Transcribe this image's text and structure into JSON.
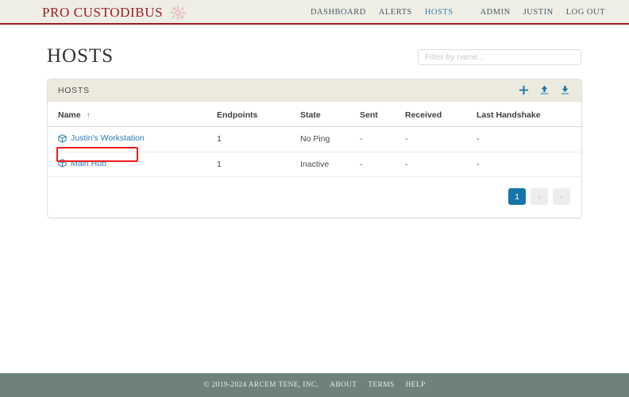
{
  "colors": {
    "brand_red": "#9b1b28",
    "header_bg": "#eeeee4",
    "link_blue": "#2a7ab0",
    "accent_blue": "#1675a8",
    "danger_red": "#f0554c",
    "footer_bg": "#6e8279",
    "annotation_red": "#ee1b1b"
  },
  "header": {
    "brand_name": "PRO CUSTODIBUS",
    "logo_icon": "sunburst-emblem-icon",
    "nav_primary": [
      {
        "label": "DASHBOARD",
        "active": false
      },
      {
        "label": "ALERTS",
        "active": false
      },
      {
        "label": "HOSTS",
        "active": true
      }
    ],
    "nav_secondary": [
      {
        "label": "ADMIN"
      },
      {
        "label": "JUSTIN"
      },
      {
        "label": "LOG OUT"
      }
    ]
  },
  "page": {
    "title": "HOSTS"
  },
  "search": {
    "placeholder": "Filter by name...",
    "value": ""
  },
  "card": {
    "title": "HOSTS",
    "actions": [
      {
        "name": "add-host-button",
        "icon": "plus-icon"
      },
      {
        "name": "upload-hosts-button",
        "icon": "upload-icon"
      },
      {
        "name": "download-hosts-button",
        "icon": "download-icon"
      }
    ]
  },
  "table": {
    "columns": [
      {
        "key": "name",
        "label": "Name",
        "sorted": true,
        "sort_arrow": "↑"
      },
      {
        "key": "endpoints",
        "label": "Endpoints"
      },
      {
        "key": "state",
        "label": "State"
      },
      {
        "key": "sent",
        "label": "Sent"
      },
      {
        "key": "received",
        "label": "Received"
      },
      {
        "key": "handshake",
        "label": "Last Handshake"
      }
    ],
    "rows": [
      {
        "name": "Justin's Workstation",
        "icon": "cube-icon",
        "endpoints": "1",
        "state": "No Ping",
        "state_style": "danger",
        "sent": "-",
        "received": "-",
        "handshake": "-",
        "highlighted": true
      },
      {
        "name": "Main Hub",
        "icon": "cube-icon",
        "endpoints": "1",
        "state": "Inactive",
        "state_style": "normal",
        "sent": "-",
        "received": "-",
        "handshake": "-",
        "highlighted": false
      }
    ]
  },
  "pagination": {
    "current_page": "1",
    "prev_label": "‹",
    "next_label": "›",
    "prev_disabled": true,
    "next_disabled": true
  },
  "footer": {
    "copyright": "© 2019-2024 ARCEM TENE, INC.",
    "links": [
      {
        "label": "ABOUT"
      },
      {
        "label": "TERMS"
      },
      {
        "label": "HELP"
      }
    ]
  }
}
